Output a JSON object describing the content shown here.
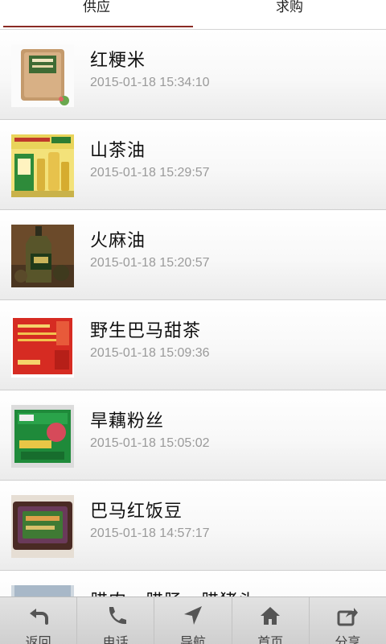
{
  "tabs": [
    {
      "label": "供应",
      "active": true
    },
    {
      "label": "求购",
      "active": false
    }
  ],
  "items": [
    {
      "title": "红粳米",
      "time": "2015-01-18 15:34:10",
      "image": "rice-bag-image"
    },
    {
      "title": "山茶油",
      "time": "2015-01-18 15:29:57",
      "image": "camellia-oil-image"
    },
    {
      "title": "火麻油",
      "time": "2015-01-18 15:20:57",
      "image": "hemp-oil-image"
    },
    {
      "title": "野生巴马甜茶",
      "time": "2015-01-18 15:09:36",
      "image": "sweet-tea-box-image"
    },
    {
      "title": "旱藕粉丝",
      "time": "2015-01-18 15:05:02",
      "image": "lotus-vermicelli-box-image"
    },
    {
      "title": "巴马红饭豆",
      "time": "2015-01-18 14:57:17",
      "image": "red-bean-bag-image"
    },
    {
      "title": "腊肉、腊肠、腊猪头",
      "time": "",
      "image": "cured-meat-image"
    }
  ],
  "nav": [
    {
      "label": "返回",
      "icon": "back-arrow-icon"
    },
    {
      "label": "电话",
      "icon": "phone-icon"
    },
    {
      "label": "导航",
      "icon": "navigation-arrow-icon"
    },
    {
      "label": "首页",
      "icon": "home-icon"
    },
    {
      "label": "分享",
      "icon": "share-icon"
    }
  ],
  "colors": {
    "tab_indicator": "#8a2b24",
    "time_text": "#9a9a9a",
    "nav_bg": "#d8d8d8"
  }
}
